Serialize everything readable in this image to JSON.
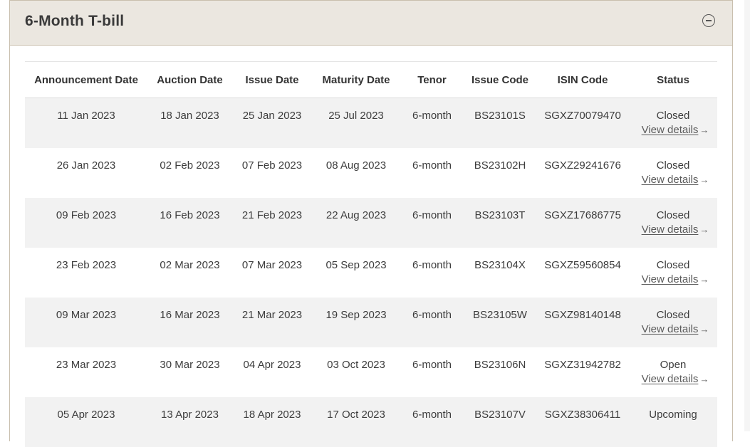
{
  "panel": {
    "title": "6-Month T-bill"
  },
  "table": {
    "headers": [
      "Announcement Date",
      "Auction Date",
      "Issue Date",
      "Maturity Date",
      "Tenor",
      "Issue Code",
      "ISIN Code",
      "Status"
    ],
    "rows": [
      {
        "announcement": "11 Jan 2023",
        "auction": "18 Jan 2023",
        "issue": "25 Jan 2023",
        "maturity": "25 Jul 2023",
        "tenor": "6-month",
        "issue_code": "BS23101S",
        "isin": "SGXZ70079470",
        "status": "Closed",
        "link": "View details"
      },
      {
        "announcement": "26 Jan 2023",
        "auction": "02 Feb 2023",
        "issue": "07 Feb 2023",
        "maturity": "08 Aug 2023",
        "tenor": "6-month",
        "issue_code": "BS23102H",
        "isin": "SGXZ29241676",
        "status": "Closed",
        "link": "View details"
      },
      {
        "announcement": "09 Feb 2023",
        "auction": "16 Feb 2023",
        "issue": "21 Feb 2023",
        "maturity": "22 Aug 2023",
        "tenor": "6-month",
        "issue_code": "BS23103T",
        "isin": "SGXZ17686775",
        "status": "Closed",
        "link": "View details"
      },
      {
        "announcement": "23 Feb 2023",
        "auction": "02 Mar 2023",
        "issue": "07 Mar 2023",
        "maturity": "05 Sep 2023",
        "tenor": "6-month",
        "issue_code": "BS23104X",
        "isin": "SGXZ59560854",
        "status": "Closed",
        "link": "View details"
      },
      {
        "announcement": "09 Mar 2023",
        "auction": "16 Mar 2023",
        "issue": "21 Mar 2023",
        "maturity": "19 Sep 2023",
        "tenor": "6-month",
        "issue_code": "BS23105W",
        "isin": "SGXZ98140148",
        "status": "Closed",
        "link": "View details"
      },
      {
        "announcement": "23 Mar 2023",
        "auction": "30 Mar 2023",
        "issue": "04 Apr 2023",
        "maturity": "03 Oct 2023",
        "tenor": "6-month",
        "issue_code": "BS23106N",
        "isin": "SGXZ31942782",
        "status": "Open",
        "link": "View details"
      },
      {
        "announcement": "05 Apr 2023",
        "auction": "13 Apr 2023",
        "issue": "18 Apr 2023",
        "maturity": "17 Oct 2023",
        "tenor": "6-month",
        "issue_code": "BS23107V",
        "isin": "SGXZ38306411",
        "status": "Upcoming",
        "link": ""
      }
    ]
  },
  "icons": {
    "collapse": "minus-circle-icon",
    "link_arrow": "arrow-right-icon"
  },
  "colors": {
    "header_bg": "#ebe7e0",
    "border": "#c9bfae",
    "row_alt": "#f2f2f2"
  }
}
